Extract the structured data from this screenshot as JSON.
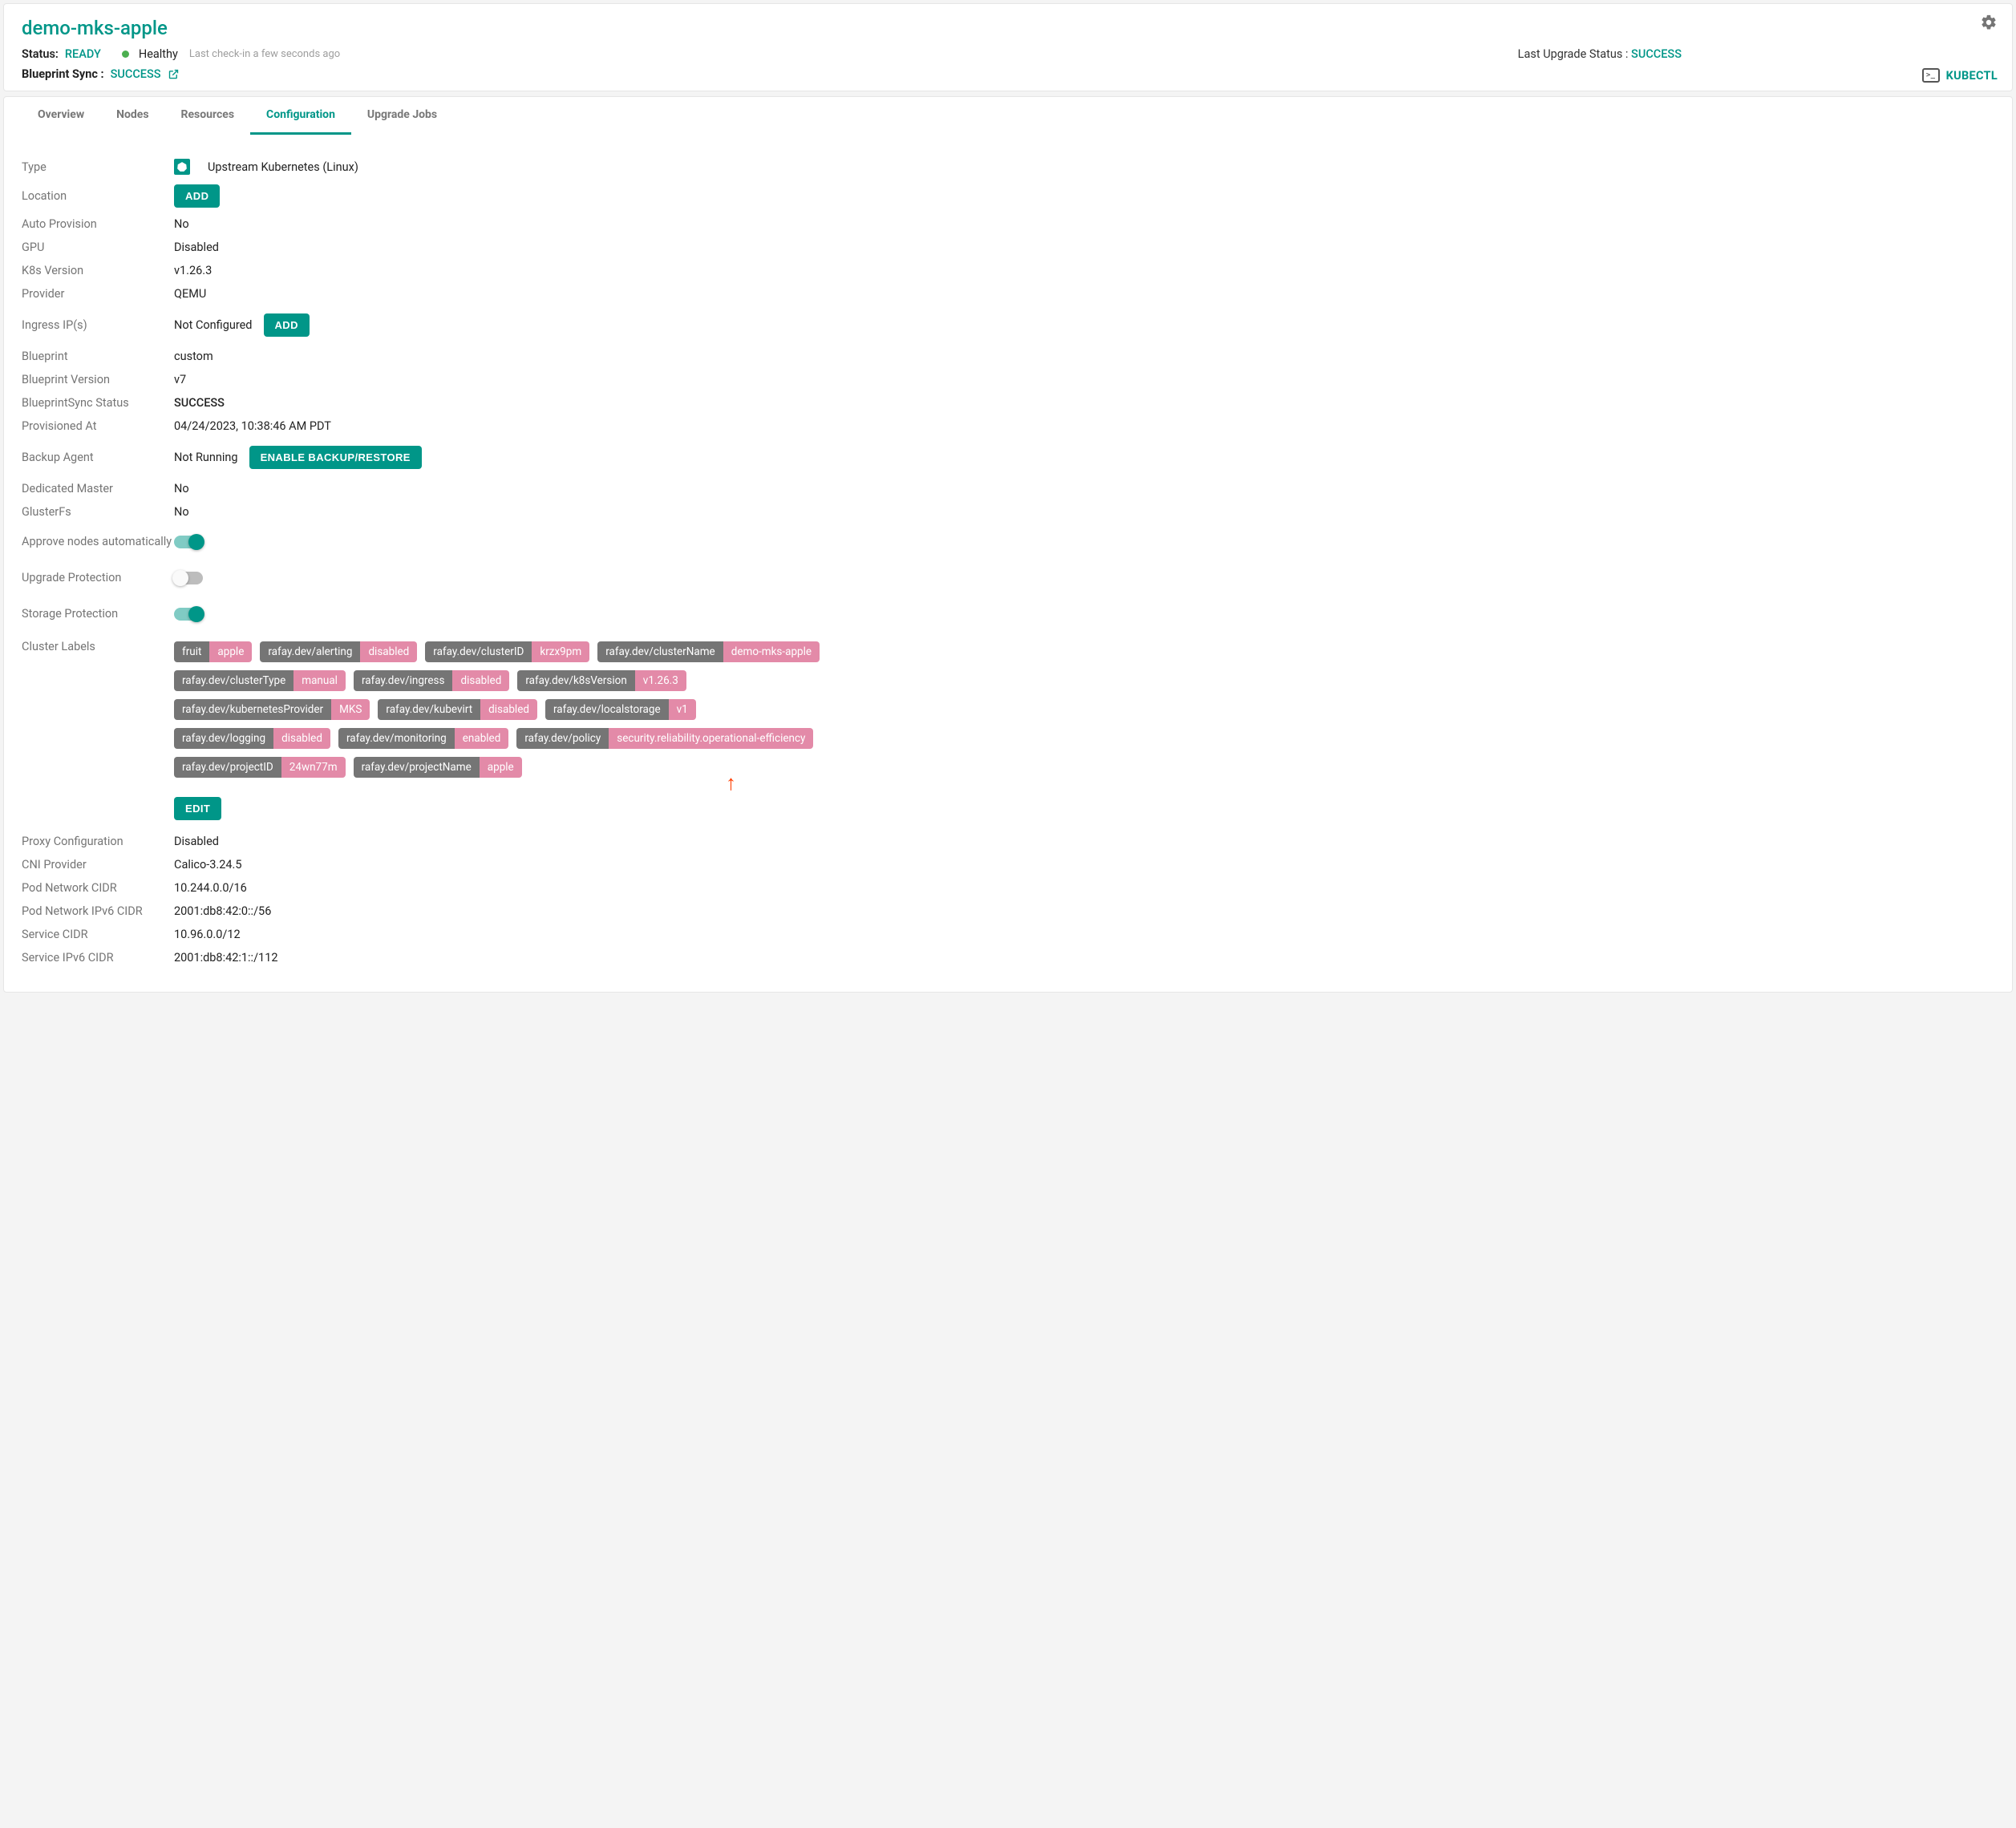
{
  "header": {
    "title": "demo-mks-apple",
    "status_label": "Status:",
    "status_value": "READY",
    "health": "Healthy",
    "last_checkin": "Last check-in a few seconds ago",
    "upgrade_label": "Last Upgrade Status :",
    "upgrade_value": "SUCCESS",
    "bp_sync_label": "Blueprint Sync :",
    "bp_sync_value": "SUCCESS",
    "kubectl": "KUBECTL"
  },
  "tabs": {
    "overview": "Overview",
    "nodes": "Nodes",
    "resources": "Resources",
    "configuration": "Configuration",
    "upgrade_jobs": "Upgrade Jobs"
  },
  "config": {
    "type_label": "Type",
    "type_value": "Upstream Kubernetes (Linux)",
    "location_label": "Location",
    "add_btn": "ADD",
    "auto_provision_label": "Auto Provision",
    "auto_provision_value": "No",
    "gpu_label": "GPU",
    "gpu_value": "Disabled",
    "k8s_version_label": "K8s Version",
    "k8s_version_value": "v1.26.3",
    "provider_label": "Provider",
    "provider_value": "QEMU",
    "ingress_label": "Ingress IP(s)",
    "ingress_value": "Not Configured",
    "blueprint_label": "Blueprint",
    "blueprint_value": "custom",
    "bp_version_label": "Blueprint Version",
    "bp_version_value": "v7",
    "bp_sync_status_label": "BlueprintSync Status",
    "bp_sync_status_value": "SUCCESS",
    "provisioned_label": "Provisioned At",
    "provisioned_value": "04/24/2023, 10:38:46 AM PDT",
    "backup_label": "Backup Agent",
    "backup_value": "Not Running",
    "backup_btn": "ENABLE BACKUP/RESTORE",
    "dedicated_master_label": "Dedicated Master",
    "dedicated_master_value": "No",
    "glusterfs_label": "GlusterFs",
    "glusterfs_value": "No",
    "approve_nodes_label": "Approve nodes automatically",
    "upgrade_protection_label": "Upgrade Protection",
    "storage_protection_label": "Storage Protection",
    "cluster_labels_label": "Cluster Labels",
    "edit_btn": "EDIT",
    "proxy_label": "Proxy Configuration",
    "proxy_value": "Disabled",
    "cni_label": "CNI Provider",
    "cni_value": "Calico-3.24.5",
    "pod_cidr_label": "Pod Network CIDR",
    "pod_cidr_value": "10.244.0.0/16",
    "pod_cidr6_label": "Pod Network IPv6 CIDR",
    "pod_cidr6_value": "2001:db8:42:0::/56",
    "svc_cidr_label": "Service CIDR",
    "svc_cidr_value": "10.96.0.0/12",
    "svc_cidr6_label": "Service IPv6 CIDR",
    "svc_cidr6_value": "2001:db8:42:1::/112"
  },
  "cluster_labels": [
    {
      "k": "fruit",
      "v": "apple"
    },
    {
      "k": "rafay.dev/alerting",
      "v": "disabled"
    },
    {
      "k": "rafay.dev/clusterID",
      "v": "krzx9pm"
    },
    {
      "k": "rafay.dev/clusterName",
      "v": "demo-mks-apple"
    },
    {
      "k": "rafay.dev/clusterType",
      "v": "manual"
    },
    {
      "k": "rafay.dev/ingress",
      "v": "disabled"
    },
    {
      "k": "rafay.dev/k8sVersion",
      "v": "v1.26.3"
    },
    {
      "k": "rafay.dev/kubernetesProvider",
      "v": "MKS"
    },
    {
      "k": "rafay.dev/kubevirt",
      "v": "disabled"
    },
    {
      "k": "rafay.dev/localstorage",
      "v": "v1"
    },
    {
      "k": "rafay.dev/logging",
      "v": "disabled"
    },
    {
      "k": "rafay.dev/monitoring",
      "v": "enabled"
    },
    {
      "k": "rafay.dev/policy",
      "v": "security.reliability.operational-efficiency"
    },
    {
      "k": "rafay.dev/projectID",
      "v": "24wn77m"
    },
    {
      "k": "rafay.dev/projectName",
      "v": "apple"
    }
  ]
}
